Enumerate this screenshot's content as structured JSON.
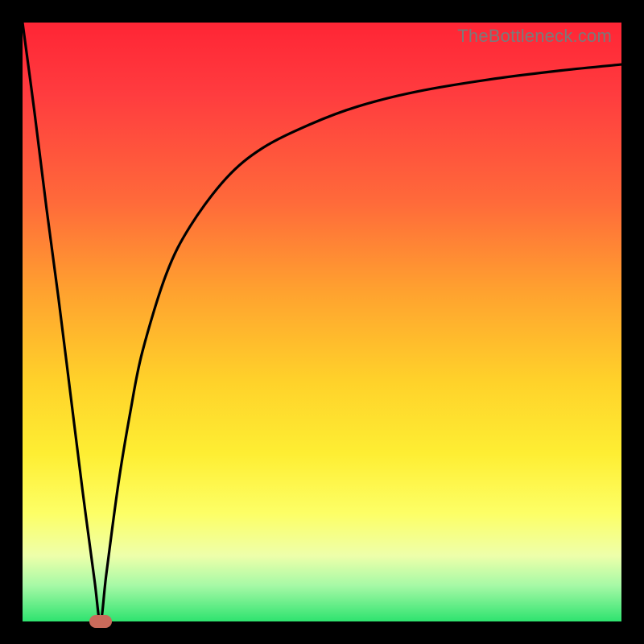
{
  "watermark": "TheBottleneck.com",
  "colors": {
    "frame": "#000000",
    "gradient_top": "#ff2535",
    "gradient_mid": "#ffd22a",
    "gradient_bottom": "#2ee36f",
    "curve": "#000000",
    "marker": "#c96a5a"
  },
  "chart_data": {
    "type": "line",
    "title": "",
    "xlabel": "",
    "ylabel": "",
    "xlim": [
      0,
      100
    ],
    "ylim": [
      0,
      100
    ],
    "grid": false,
    "series": [
      {
        "name": "bottleneck-curve",
        "x": [
          0,
          2,
          4,
          6,
          8,
          10,
          12,
          13,
          14,
          16,
          18,
          20,
          24,
          28,
          34,
          40,
          48,
          56,
          66,
          78,
          90,
          100
        ],
        "y": [
          100,
          85,
          69,
          54,
          38,
          22,
          7,
          0,
          8,
          23,
          35,
          45,
          58,
          66,
          74,
          79,
          83,
          86,
          88.5,
          90.5,
          92,
          93
        ]
      }
    ],
    "annotations": [
      {
        "type": "marker",
        "shape": "pill",
        "x": 13,
        "y": 0,
        "color": "#c96a5a"
      }
    ]
  }
}
